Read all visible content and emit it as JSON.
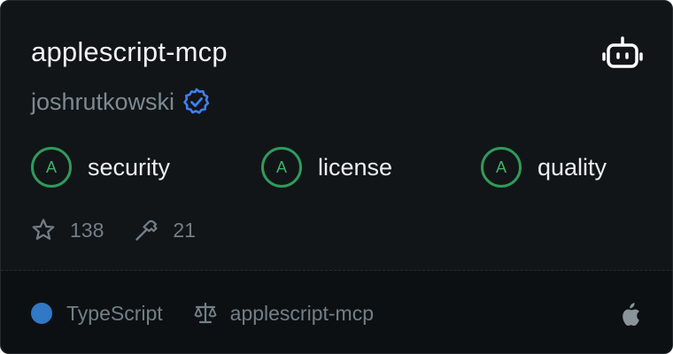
{
  "server": {
    "name": "applescript-mcp",
    "author": "joshrutkowski",
    "author_verified": true
  },
  "grades": [
    {
      "grade": "A",
      "label": "security"
    },
    {
      "grade": "A",
      "label": "license"
    },
    {
      "grade": "A",
      "label": "quality"
    }
  ],
  "stats": {
    "stars": "138",
    "tools": "21"
  },
  "footer": {
    "language": "TypeScript",
    "language_color": "#3178c6",
    "license": "applescript-mcp",
    "platform_icon": "apple-icon"
  },
  "icons": {
    "top_right": "robot-icon",
    "verified": "verified-badge-icon",
    "stars": "star-icon",
    "tools": "hammer-icon",
    "license": "scale-icon"
  },
  "colors": {
    "card_bg": "#111518",
    "footer_bg": "#0d1013",
    "grade_green": "#2f9a5c",
    "verified_blue": "#3b82f6"
  }
}
